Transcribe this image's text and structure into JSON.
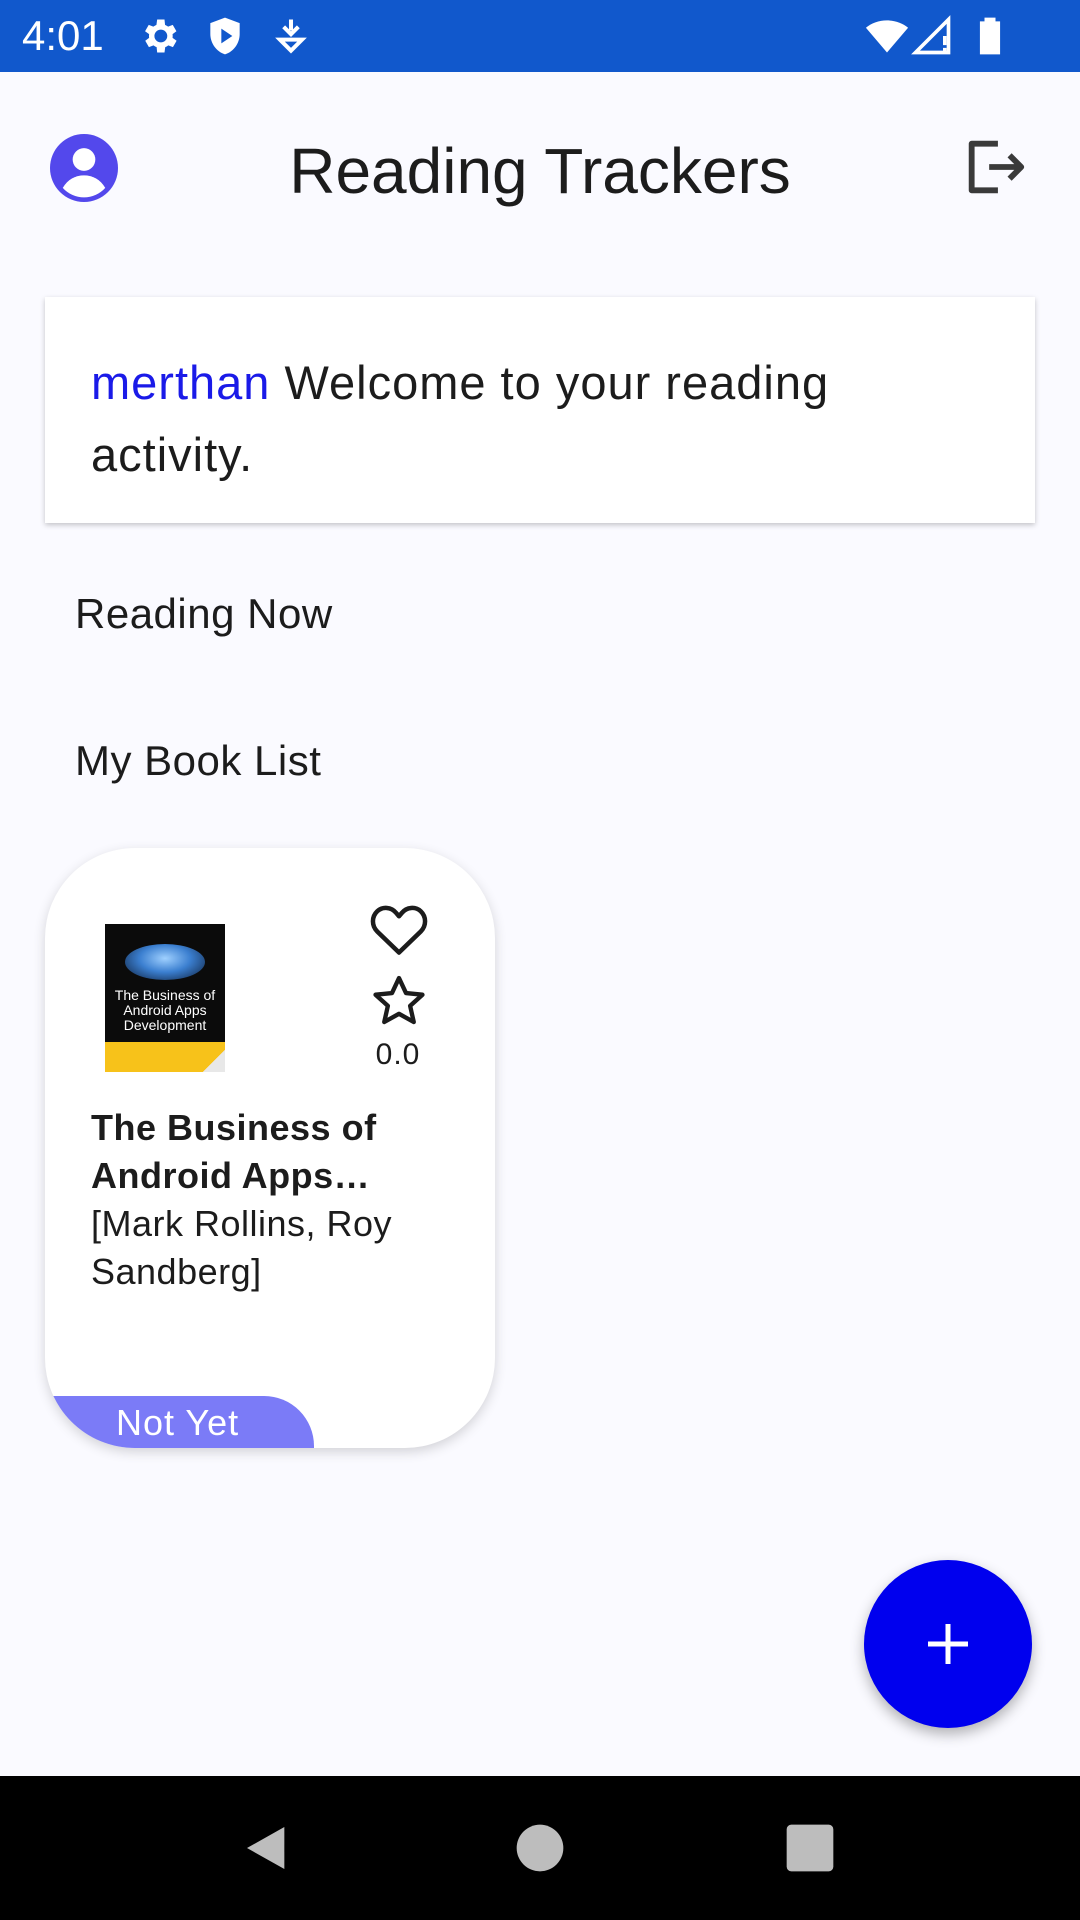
{
  "status_bar": {
    "time": "4:01",
    "icons": [
      "settings-icon",
      "shield-icon",
      "download-icon",
      "wifi-icon",
      "signal-icon",
      "battery-icon"
    ],
    "background": "#1158cc"
  },
  "app_bar": {
    "title": "Reading Trackers",
    "profile_icon": "account-circle-icon",
    "logout_icon": "logout-icon",
    "accent": "#5348ec"
  },
  "welcome": {
    "username": "merthan",
    "message": " Welcome to your reading activity.",
    "username_color": "#1a1ae8"
  },
  "sections": {
    "reading_now": "Reading Now",
    "book_list": "My Book List"
  },
  "books": [
    {
      "title": "The Business of Android Apps Development",
      "authors": "[Mark Rollins, Roy Sandberg]",
      "rating": "0.0",
      "status": "Not Yet",
      "favorite": false,
      "cover_title": "The Business of Android Apps Development",
      "status_color": "#7b7bf7"
    }
  ],
  "fab": {
    "icon": "plus-icon",
    "color": "#0000ee"
  },
  "nav_bar": {
    "icons": [
      "back-icon",
      "home-icon",
      "recents-icon"
    ]
  }
}
